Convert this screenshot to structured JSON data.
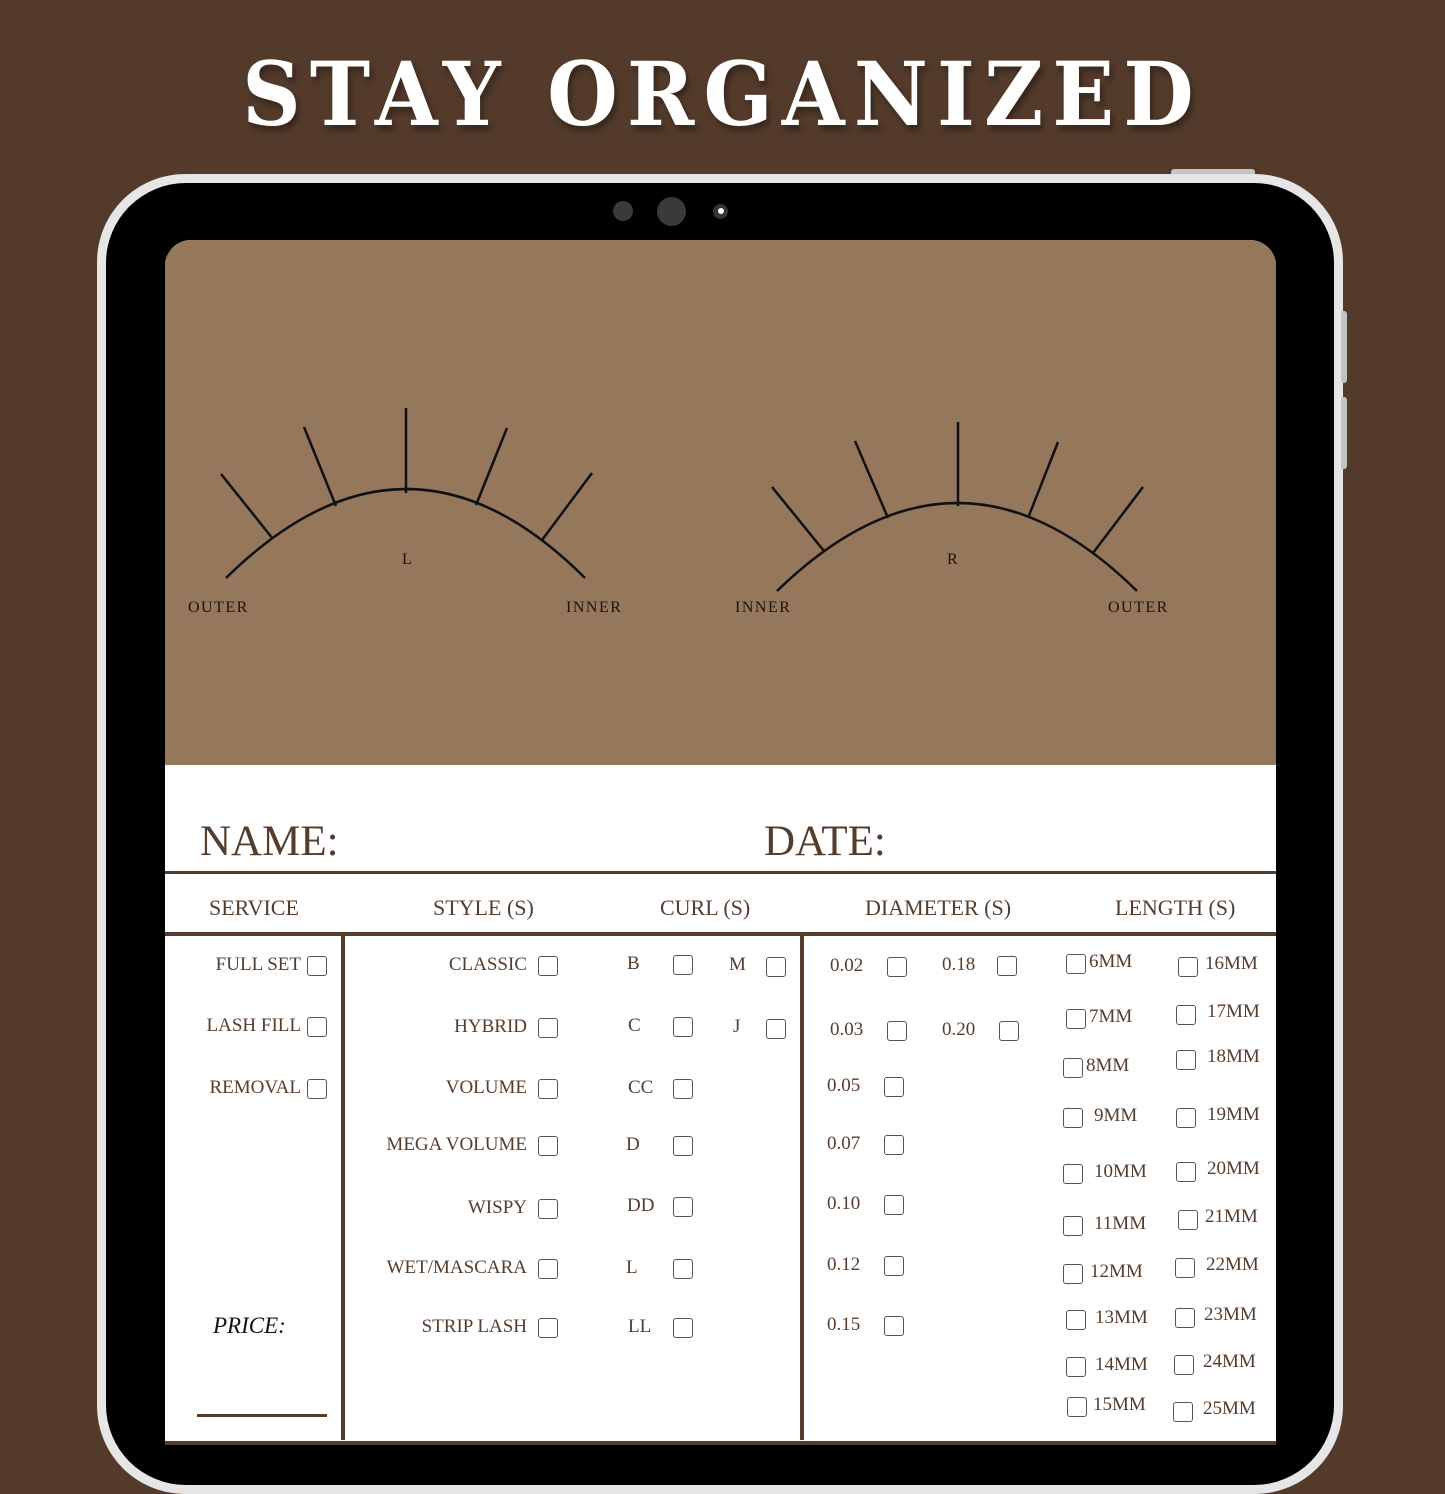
{
  "headline": "STAY ORGANIZED",
  "colors": {
    "background": "#533a2b",
    "lash_panel": "#95775c",
    "form_text": "#553d2d",
    "tablet_frame": "#e6e6e6",
    "bezel": "#000000"
  },
  "lash_map": {
    "left_eye": {
      "label": "L",
      "left_text": "OUTER",
      "right_text": "INNER"
    },
    "right_eye": {
      "label": "R",
      "left_text": "INNER",
      "right_text": "OUTER"
    }
  },
  "form": {
    "name_label": "NAME:",
    "date_label": "DATE:",
    "price_label": "PRICE:",
    "columns": {
      "service": "SERVICE",
      "style": "STYLE (S)",
      "curl": "CURL (S)",
      "diameter": "DIAMETER (S)",
      "length": "LENGTH (S)"
    },
    "service_options": [
      "FULL SET",
      "LASH FILL",
      "REMOVAL"
    ],
    "style_options": [
      "CLASSIC",
      "HYBRID",
      "VOLUME",
      "MEGA VOLUME",
      "WISPY",
      "WET/MASCARA",
      "STRIP LASH"
    ],
    "curl_options_col1": [
      "B",
      "C",
      "CC",
      "D",
      "DD",
      "L",
      "LL"
    ],
    "curl_options_col2": [
      "M",
      "J"
    ],
    "diameter_options_col1": [
      "0.02",
      "0.03",
      "0.05",
      "0.07",
      "0.10",
      "0.12",
      "0.15"
    ],
    "diameter_options_col2": [
      "0.18",
      "0.20"
    ],
    "length_options_col1": [
      "6MM",
      "7MM",
      "8MM",
      "9MM",
      "10MM",
      "11MM",
      "12MM",
      "13MM",
      "14MM",
      "15MM"
    ],
    "length_options_col2": [
      "16MM",
      "17MM",
      "18MM",
      "19MM",
      "20MM",
      "21MM",
      "22MM",
      "23MM",
      "24MM",
      "25MM"
    ]
  }
}
